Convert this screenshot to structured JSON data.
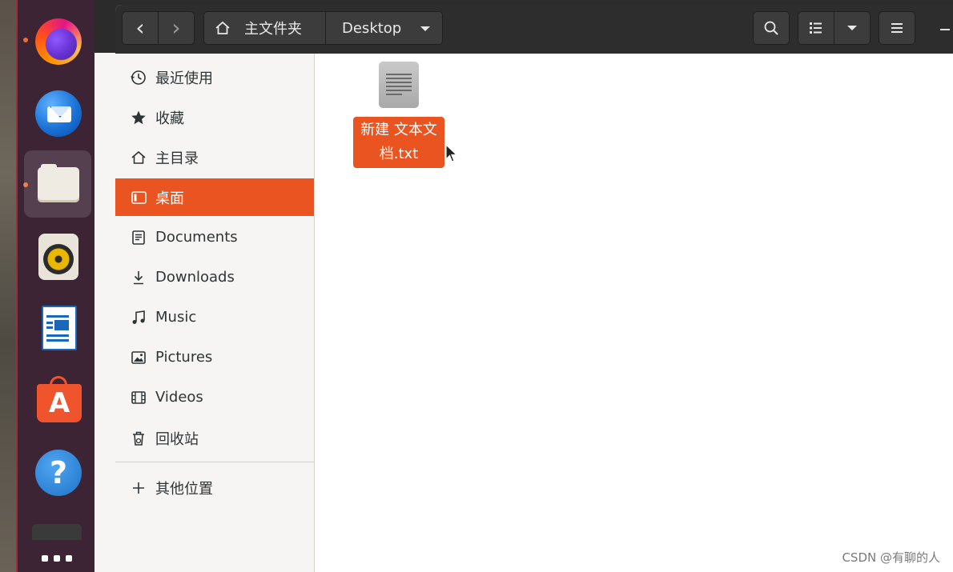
{
  "dock": {
    "apps": [
      {
        "name": "firefox-icon",
        "running": true
      },
      {
        "name": "thunderbird-icon",
        "running": false
      },
      {
        "name": "files-icon",
        "running": true,
        "active": true
      },
      {
        "name": "rhythmbox-icon",
        "running": false
      },
      {
        "name": "libreoffice-writer-icon",
        "running": false
      },
      {
        "name": "app-center-icon",
        "running": false
      },
      {
        "name": "help-icon",
        "running": false
      }
    ],
    "help_glyph": "?",
    "appcenter_glyph": "A"
  },
  "headerbar": {
    "back_glyph": "‹",
    "forward_glyph": "›",
    "home_label": "主文件夹",
    "current_label": "Desktop"
  },
  "sidebar": {
    "items": [
      {
        "label": "最近使用",
        "icon": "clock-icon"
      },
      {
        "label": "收藏",
        "icon": "star-icon"
      },
      {
        "label": "主目录",
        "icon": "home-icon"
      },
      {
        "label": "桌面",
        "icon": "desktop-icon",
        "selected": true
      },
      {
        "label": "Documents",
        "icon": "document-icon"
      },
      {
        "label": "Downloads",
        "icon": "download-icon"
      },
      {
        "label": "Music",
        "icon": "music-icon"
      },
      {
        "label": "Pictures",
        "icon": "picture-icon"
      },
      {
        "label": "Videos",
        "icon": "video-icon"
      },
      {
        "label": "回收站",
        "icon": "trash-icon"
      }
    ],
    "other_locations": {
      "label": "其他位置",
      "icon": "plus-icon"
    }
  },
  "content": {
    "files": [
      {
        "name_line1": "新建 文本文",
        "name_line2": "档.txt",
        "selected": true
      }
    ]
  },
  "watermark": "CSDN @有聊的人",
  "colors": {
    "accent": "#e95420",
    "dock_bg": "#3c2435",
    "headerbar_bg": "#2d2d2d"
  }
}
